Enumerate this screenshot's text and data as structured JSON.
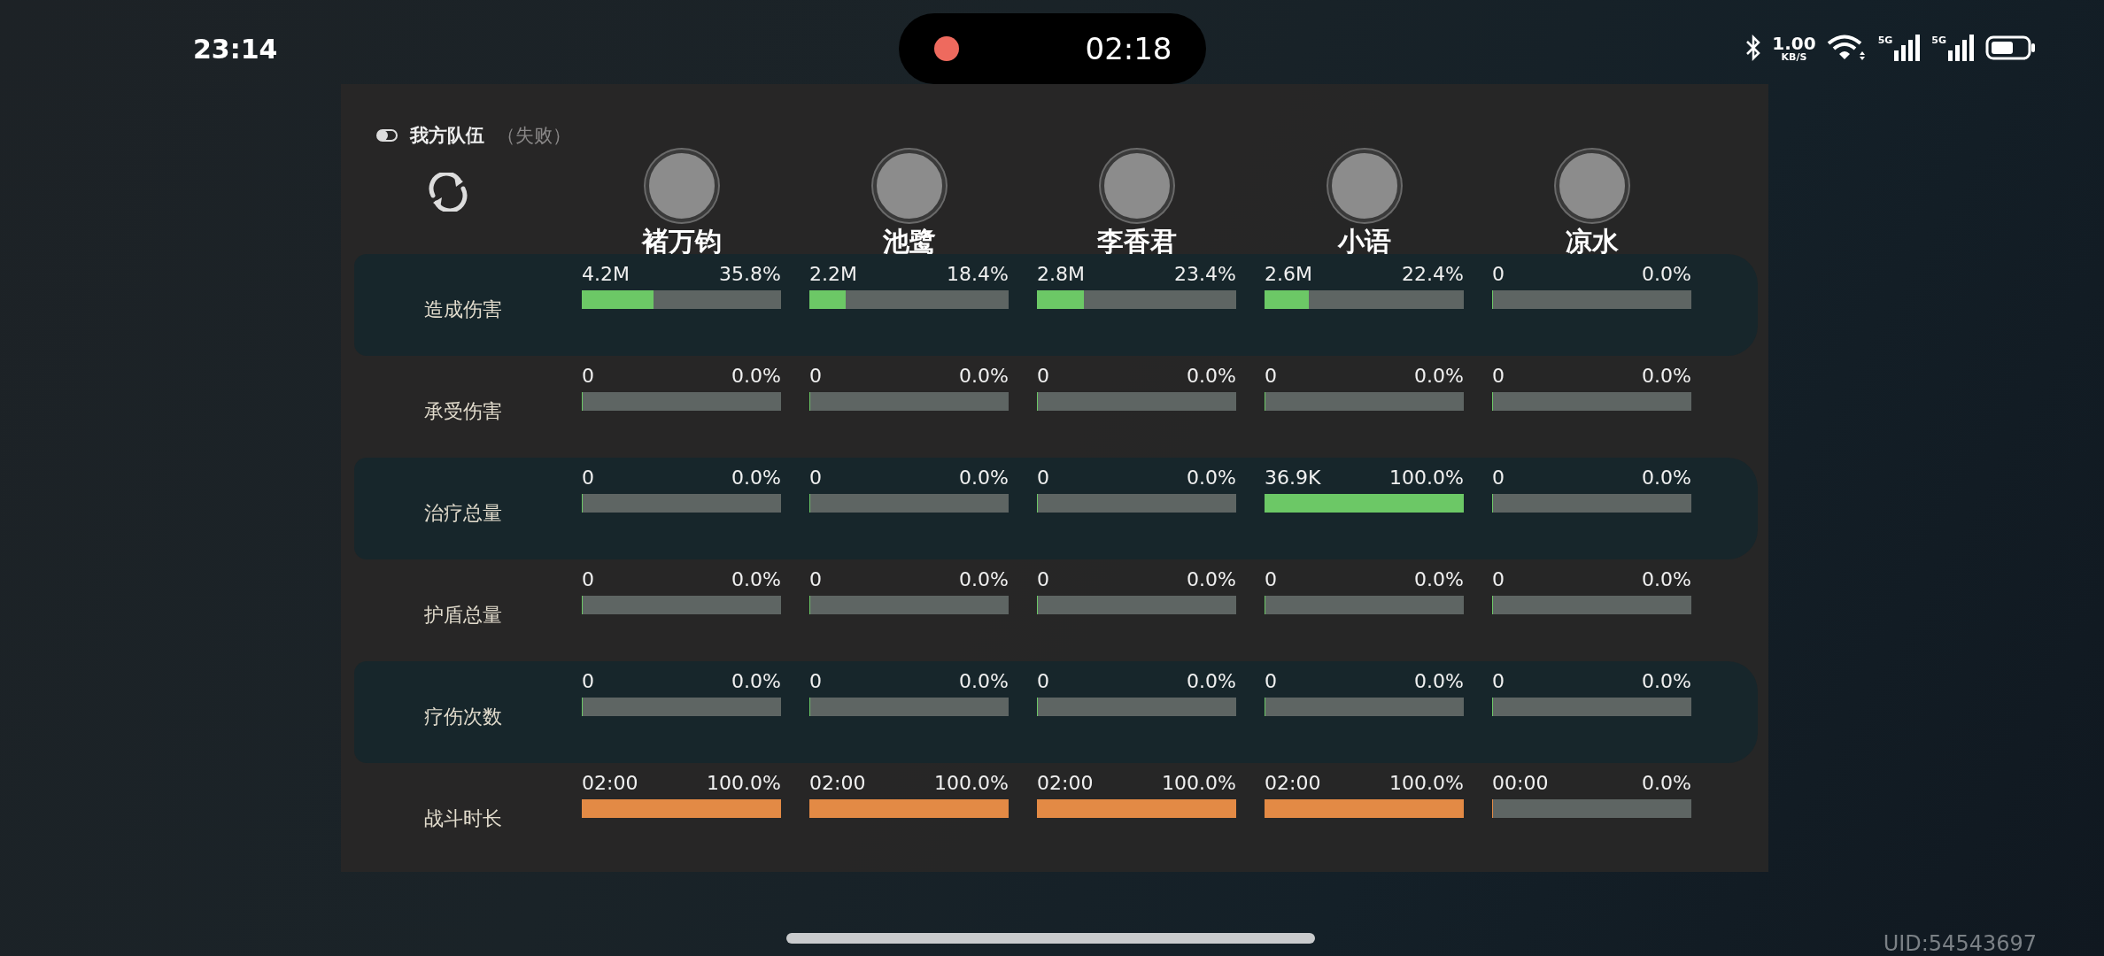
{
  "status_bar": {
    "time": "23:14",
    "recording_time": "02:18",
    "net_speed": "1.00",
    "net_unit": "KB/S",
    "sim_labels": [
      "5G",
      "5G"
    ]
  },
  "panel": {
    "title": "我方队伍",
    "result": "（失败）",
    "players": [
      {
        "name": "褚万钧"
      },
      {
        "name": "池鹭"
      },
      {
        "name": "李香君"
      },
      {
        "name": "小语"
      },
      {
        "name": "凉水"
      }
    ],
    "stats": [
      {
        "label": "造成伤害",
        "highlighted": true,
        "color": "#6cc866",
        "cells": [
          {
            "value": "4.2M",
            "percent": "35.8%",
            "level": 0.358
          },
          {
            "value": "2.2M",
            "percent": "18.4%",
            "level": 0.184
          },
          {
            "value": "2.8M",
            "percent": "23.4%",
            "level": 0.234
          },
          {
            "value": "2.6M",
            "percent": "22.4%",
            "level": 0.224
          },
          {
            "value": "0",
            "percent": "0.0%",
            "level": 0
          }
        ]
      },
      {
        "label": "承受伤害",
        "highlighted": false,
        "color": "#6cc866",
        "cells": [
          {
            "value": "0",
            "percent": "0.0%",
            "level": 0
          },
          {
            "value": "0",
            "percent": "0.0%",
            "level": 0
          },
          {
            "value": "0",
            "percent": "0.0%",
            "level": 0
          },
          {
            "value": "0",
            "percent": "0.0%",
            "level": 0
          },
          {
            "value": "0",
            "percent": "0.0%",
            "level": 0
          }
        ]
      },
      {
        "label": "治疗总量",
        "highlighted": true,
        "color": "#6cc866",
        "cells": [
          {
            "value": "0",
            "percent": "0.0%",
            "level": 0
          },
          {
            "value": "0",
            "percent": "0.0%",
            "level": 0
          },
          {
            "value": "0",
            "percent": "0.0%",
            "level": 0
          },
          {
            "value": "36.9K",
            "percent": "100.0%",
            "level": 1
          },
          {
            "value": "0",
            "percent": "0.0%",
            "level": 0
          }
        ]
      },
      {
        "label": "护盾总量",
        "highlighted": false,
        "color": "#6cc866",
        "cells": [
          {
            "value": "0",
            "percent": "0.0%",
            "level": 0
          },
          {
            "value": "0",
            "percent": "0.0%",
            "level": 0
          },
          {
            "value": "0",
            "percent": "0.0%",
            "level": 0
          },
          {
            "value": "0",
            "percent": "0.0%",
            "level": 0
          },
          {
            "value": "0",
            "percent": "0.0%",
            "level": 0
          }
        ]
      },
      {
        "label": "疗伤次数",
        "highlighted": true,
        "color": "#6cc866",
        "cells": [
          {
            "value": "0",
            "percent": "0.0%",
            "level": 0
          },
          {
            "value": "0",
            "percent": "0.0%",
            "level": 0
          },
          {
            "value": "0",
            "percent": "0.0%",
            "level": 0
          },
          {
            "value": "0",
            "percent": "0.0%",
            "level": 0
          },
          {
            "value": "0",
            "percent": "0.0%",
            "level": 0
          }
        ]
      },
      {
        "label": "战斗时长",
        "highlighted": false,
        "color": "#e38a45",
        "cells": [
          {
            "value": "02:00",
            "percent": "100.0%",
            "level": 1
          },
          {
            "value": "02:00",
            "percent": "100.0%",
            "level": 1
          },
          {
            "value": "02:00",
            "percent": "100.0%",
            "level": 1
          },
          {
            "value": "02:00",
            "percent": "100.0%",
            "level": 1
          },
          {
            "value": "00:00",
            "percent": "0.0%",
            "level": 0
          }
        ]
      }
    ]
  },
  "uid": "UID:54543697"
}
